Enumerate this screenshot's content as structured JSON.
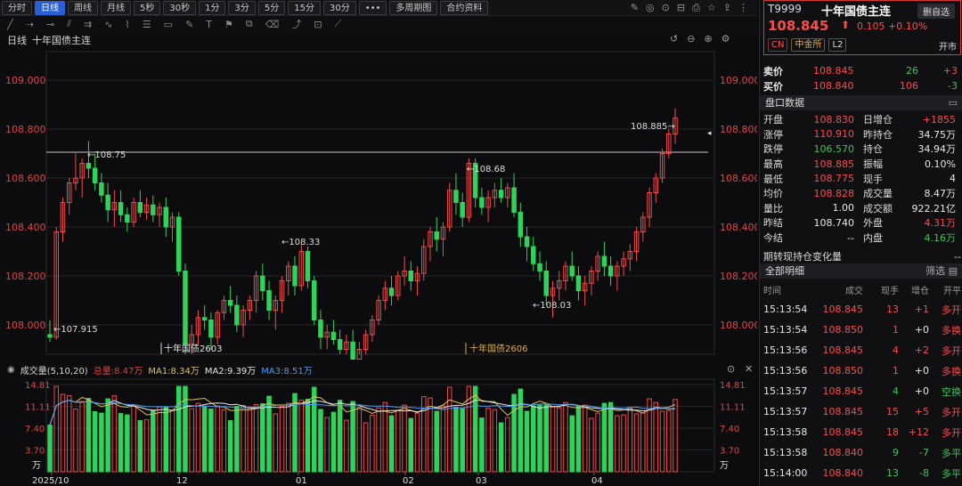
{
  "toolbar": {
    "periods": [
      "分时",
      "日线",
      "周线",
      "月线",
      "5秒",
      "30秒",
      "1分",
      "3分",
      "5分",
      "15分",
      "30分",
      "•••",
      "多周期图",
      "合约资料"
    ],
    "active_index": 1
  },
  "chart": {
    "title_period": "日线",
    "title_name": "十年国债主连",
    "price_axis_labels": [
      "109.000",
      "108.800",
      "108.600",
      "108.400",
      "108.200",
      "108.000"
    ],
    "annotations": {
      "high_left": "108.75",
      "low_left": "107.915",
      "mid_high": "108.33",
      "second_high": "108.68",
      "mid_low": "108.03",
      "last_high": "108.885"
    },
    "contract_labels": [
      "十年国债2603",
      "十年国债2606"
    ],
    "x_labels": [
      "2025/10",
      "12",
      "01",
      "02",
      "03",
      "04"
    ]
  },
  "volume": {
    "title": "成交量(5,10,20)",
    "total": "总量:8.47万",
    "ma1": "MA1:8.34万",
    "ma2": "MA2:9.39万",
    "ma3": "MA3:8.51万",
    "axis_labels": [
      "14.81",
      "11.11",
      "7.40",
      "3.70"
    ],
    "unit": "万"
  },
  "chart_data": {
    "type": "candlestick",
    "series": [
      {
        "name": "十年国债主连",
        "ohlc_approx": [
          [
            107.96,
            108.02,
            107.93,
            107.95
          ],
          [
            107.95,
            108.4,
            107.94,
            108.38
          ],
          [
            108.38,
            108.52,
            108.34,
            108.5
          ],
          [
            108.5,
            108.6,
            108.45,
            108.58
          ],
          [
            108.58,
            108.7,
            108.55,
            108.6
          ],
          [
            108.6,
            108.68,
            108.52,
            108.66
          ],
          [
            108.66,
            108.75,
            108.6,
            108.64
          ],
          [
            108.64,
            108.7,
            108.55,
            108.58
          ],
          [
            108.58,
            108.62,
            108.5,
            108.53
          ],
          [
            108.53,
            108.58,
            108.42,
            108.47
          ],
          [
            108.47,
            108.55,
            108.4,
            108.5
          ],
          [
            108.5,
            108.55,
            108.42,
            108.45
          ],
          [
            108.45,
            108.48,
            108.38,
            108.42
          ],
          [
            108.42,
            108.52,
            108.4,
            108.5
          ],
          [
            108.5,
            108.55,
            108.44,
            108.46
          ],
          [
            108.46,
            108.52,
            108.43,
            108.49
          ],
          [
            108.49,
            108.53,
            108.42,
            108.45
          ],
          [
            108.45,
            108.5,
            108.4,
            108.48
          ],
          [
            108.48,
            108.52,
            108.36,
            108.4
          ],
          [
            108.4,
            108.46,
            108.34,
            108.44
          ],
          [
            108.44,
            108.46,
            108.2,
            108.22
          ],
          [
            108.22,
            108.25,
            107.88,
            107.92
          ],
          [
            107.92,
            108.0,
            107.86,
            107.96
          ],
          [
            107.96,
            108.06,
            107.92,
            108.03
          ],
          [
            108.03,
            108.08,
            107.98,
            108.02
          ],
          [
            108.02,
            108.05,
            107.9,
            107.95
          ],
          [
            107.95,
            108.06,
            107.92,
            108.05
          ],
          [
            108.05,
            108.12,
            108.02,
            108.1
          ],
          [
            108.1,
            108.16,
            108.05,
            108.08
          ],
          [
            108.08,
            108.12,
            107.97,
            108.0
          ],
          [
            108.0,
            108.08,
            107.95,
            108.06
          ],
          [
            108.06,
            108.12,
            108.02,
            108.1
          ],
          [
            108.1,
            108.22,
            108.05,
            108.2
          ],
          [
            108.2,
            108.25,
            108.1,
            108.14
          ],
          [
            108.14,
            108.18,
            108.02,
            108.06
          ],
          [
            108.06,
            108.12,
            107.98,
            108.1
          ],
          [
            108.1,
            108.2,
            108.05,
            108.18
          ],
          [
            108.18,
            108.26,
            108.12,
            108.24
          ],
          [
            108.24,
            108.28,
            108.12,
            108.16
          ],
          [
            108.16,
            108.33,
            108.14,
            108.3
          ],
          [
            108.3,
            108.32,
            108.15,
            108.18
          ],
          [
            108.18,
            108.2,
            108.0,
            108.02
          ],
          [
            108.02,
            108.06,
            107.9,
            107.95
          ],
          [
            107.95,
            108.0,
            107.9,
            107.97
          ],
          [
            107.97,
            108.02,
            107.92,
            107.94
          ],
          [
            107.94,
            107.98,
            107.85,
            107.9
          ],
          [
            107.9,
            107.96,
            107.86,
            107.93
          ],
          [
            107.93,
            107.98,
            107.82,
            107.86
          ],
          [
            107.86,
            107.93,
            107.82,
            107.9
          ],
          [
            107.9,
            107.98,
            107.88,
            107.96
          ],
          [
            107.96,
            108.04,
            107.93,
            108.02
          ],
          [
            108.02,
            108.12,
            108.0,
            108.1
          ],
          [
            108.1,
            108.18,
            108.06,
            108.15
          ],
          [
            108.15,
            108.2,
            108.08,
            108.12
          ],
          [
            108.12,
            108.22,
            108.1,
            108.2
          ],
          [
            108.2,
            108.28,
            108.16,
            108.22
          ],
          [
            108.22,
            108.26,
            108.14,
            108.18
          ],
          [
            108.18,
            108.24,
            108.12,
            108.21
          ],
          [
            108.21,
            108.35,
            108.18,
            108.32
          ],
          [
            108.32,
            108.4,
            108.26,
            108.38
          ],
          [
            108.38,
            108.44,
            108.3,
            108.35
          ],
          [
            108.35,
            108.42,
            108.28,
            108.4
          ],
          [
            108.4,
            108.58,
            108.38,
            108.55
          ],
          [
            108.55,
            108.62,
            108.45,
            108.5
          ],
          [
            108.5,
            108.54,
            108.4,
            108.44
          ],
          [
            108.44,
            108.68,
            108.42,
            108.66
          ],
          [
            108.66,
            108.68,
            108.48,
            108.52
          ],
          [
            108.52,
            108.56,
            108.45,
            108.48
          ],
          [
            108.48,
            108.55,
            108.42,
            108.52
          ],
          [
            108.52,
            108.58,
            108.48,
            108.55
          ],
          [
            108.55,
            108.6,
            108.5,
            108.52
          ],
          [
            108.52,
            108.58,
            108.48,
            108.56
          ],
          [
            108.56,
            108.62,
            108.44,
            108.46
          ],
          [
            108.46,
            108.5,
            108.32,
            108.36
          ],
          [
            108.36,
            108.4,
            108.26,
            108.32
          ],
          [
            108.32,
            108.36,
            108.22,
            108.25
          ],
          [
            108.25,
            108.3,
            108.18,
            108.22
          ],
          [
            108.22,
            108.26,
            108.08,
            108.12
          ],
          [
            108.12,
            108.18,
            108.03,
            108.15
          ],
          [
            108.15,
            108.22,
            108.1,
            108.18
          ],
          [
            108.18,
            108.26,
            108.14,
            108.24
          ],
          [
            108.24,
            108.3,
            108.18,
            108.2
          ],
          [
            108.2,
            108.24,
            108.1,
            108.14
          ],
          [
            108.14,
            108.2,
            108.08,
            108.17
          ],
          [
            108.17,
            108.24,
            108.12,
            108.22
          ],
          [
            108.22,
            108.3,
            108.18,
            108.28
          ],
          [
            108.28,
            108.34,
            108.2,
            108.24
          ],
          [
            108.24,
            108.28,
            108.16,
            108.2
          ],
          [
            108.2,
            108.26,
            108.14,
            108.24
          ],
          [
            108.24,
            108.3,
            108.2,
            108.27
          ],
          [
            108.27,
            108.33,
            108.22,
            108.3
          ],
          [
            108.3,
            108.4,
            108.26,
            108.38
          ],
          [
            108.38,
            108.46,
            108.34,
            108.44
          ],
          [
            108.44,
            108.56,
            108.4,
            108.54
          ],
          [
            108.54,
            108.62,
            108.5,
            108.6
          ],
          [
            108.6,
            108.72,
            108.58,
            108.7
          ],
          [
            108.7,
            108.8,
            108.68,
            108.78
          ],
          [
            108.78,
            108.885,
            108.74,
            108.845
          ]
        ]
      }
    ],
    "y_axis_range": [
      107.88,
      109.0
    ],
    "volume_axis_range": [
      0,
      14.81
    ],
    "volume_unit": "万"
  },
  "panel": {
    "code": "T9999",
    "name": "十年国债主连",
    "add_btn": "删自选",
    "price": "108.845",
    "change": "0.105  +0.10%",
    "badges": [
      "CN",
      "中金所",
      "L2"
    ],
    "status": "开市",
    "ask": {
      "label": "卖价",
      "price": "108.845",
      "vol": "26",
      "diff": "+3"
    },
    "bid": {
      "label": "买价",
      "price": "108.840",
      "vol": "106",
      "diff": "-3"
    },
    "section_title": "盘口数据",
    "stats": [
      {
        "k1": "开盘",
        "v1": "108.830",
        "c1": "red",
        "k2": "日增仓",
        "v2": "+1855",
        "c2": "red"
      },
      {
        "k1": "涨停",
        "v1": "110.910",
        "c1": "red",
        "k2": "昨持仓",
        "v2": "34.75万",
        "c2": "white"
      },
      {
        "k1": "跌停",
        "v1": "106.570",
        "c1": "green",
        "k2": "持仓",
        "v2": "34.94万",
        "c2": "white"
      },
      {
        "k1": "最高",
        "v1": "108.885",
        "c1": "red",
        "k2": "振幅",
        "v2": "0.10%",
        "c2": "white"
      },
      {
        "k1": "最低",
        "v1": "108.775",
        "c1": "red",
        "k2": "现手",
        "v2": "4",
        "c2": "white"
      },
      {
        "k1": "均价",
        "v1": "108.828",
        "c1": "red",
        "k2": "成交量",
        "v2": "8.47万",
        "c2": "white"
      },
      {
        "k1": "量比",
        "v1": "1.00",
        "c1": "white",
        "k2": "成交额",
        "v2": "922.21亿",
        "c2": "white"
      },
      {
        "k1": "昨结",
        "v1": "108.740",
        "c1": "white",
        "k2": "外盘",
        "v2": "4.31万",
        "c2": "red"
      },
      {
        "k1": "今结",
        "v1": "--",
        "c1": "white",
        "k2": "内盘",
        "v2": "4.16万",
        "c2": "green"
      }
    ],
    "stat_extra": "期转现持仓变化量",
    "stat_extra_val": "--",
    "trades_title": "全部明细",
    "filter": "筛选",
    "trade_headers": [
      "时间",
      "成交",
      "现手",
      "增仓",
      "开平"
    ],
    "trades": [
      {
        "t": "15:13:54",
        "p": "108.845",
        "pc": "red",
        "v": "13",
        "vc": "red",
        "d": "+1",
        "dc": "red",
        "o": "多开",
        "oc": "red"
      },
      {
        "t": "15:13:54",
        "p": "108.850",
        "pc": "red",
        "v": "1",
        "vc": "red",
        "d": "+0",
        "dc": "white",
        "o": "多换",
        "oc": "red"
      },
      {
        "t": "15:13:56",
        "p": "108.845",
        "pc": "red",
        "v": "4",
        "vc": "red",
        "d": "+2",
        "dc": "red",
        "o": "多开",
        "oc": "red"
      },
      {
        "t": "15:13:56",
        "p": "108.850",
        "pc": "red",
        "v": "1",
        "vc": "red",
        "d": "+0",
        "dc": "white",
        "o": "多换",
        "oc": "red"
      },
      {
        "t": "15:13:57",
        "p": "108.845",
        "pc": "red",
        "v": "4",
        "vc": "green",
        "d": "+0",
        "dc": "white",
        "o": "空换",
        "oc": "green"
      },
      {
        "t": "15:13:57",
        "p": "108.845",
        "pc": "red",
        "v": "15",
        "vc": "red",
        "d": "+5",
        "dc": "red",
        "o": "多开",
        "oc": "red"
      },
      {
        "t": "15:13:58",
        "p": "108.845",
        "pc": "red",
        "v": "18",
        "vc": "red",
        "d": "+12",
        "dc": "red",
        "o": "多开",
        "oc": "red"
      },
      {
        "t": "15:13:58",
        "p": "108.840",
        "pc": "red",
        "v": "9",
        "vc": "green",
        "d": "-7",
        "dc": "green",
        "o": "多平",
        "oc": "green"
      },
      {
        "t": "15:14:00",
        "p": "108.840",
        "pc": "red",
        "v": "13",
        "vc": "green",
        "d": "-8",
        "dc": "green",
        "o": "多平",
        "oc": "green"
      }
    ]
  }
}
